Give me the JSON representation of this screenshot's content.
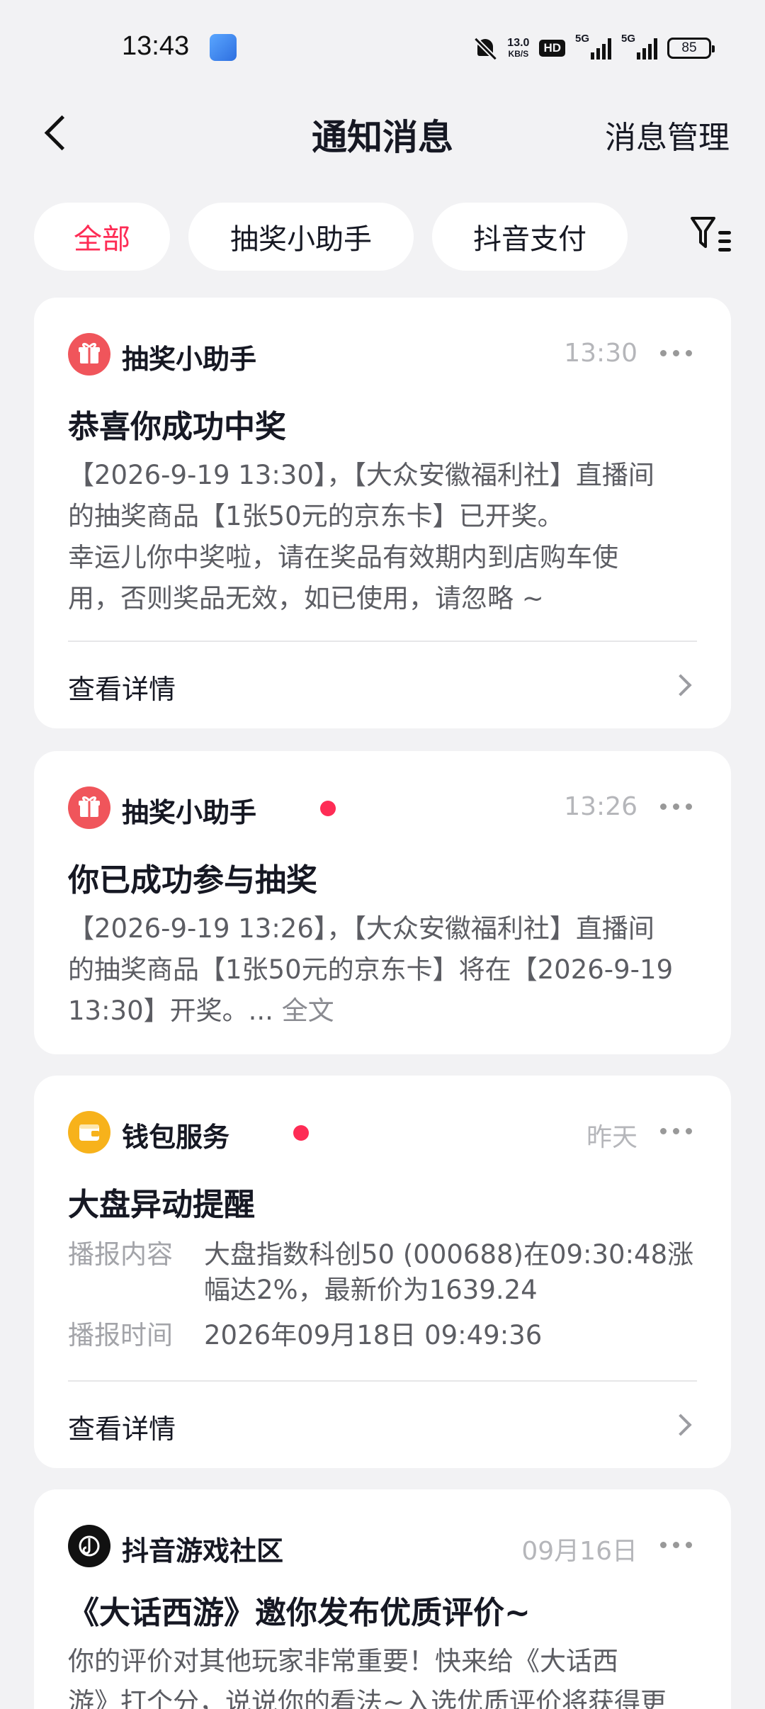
{
  "status_bar": {
    "time": "13:43",
    "net_speed_value": "13.0",
    "net_speed_unit": "KB/S",
    "hd": "HD",
    "signal1": "5G",
    "signal2": "5G",
    "battery": "85"
  },
  "nav": {
    "title": "通知消息",
    "manage": "消息管理"
  },
  "filters": {
    "items": [
      "全部",
      "抽奖小助手",
      "抖音支付"
    ],
    "active_index": 0
  },
  "cards": [
    {
      "sender": "抽奖小助手",
      "time": "13:30",
      "title": "恭喜你成功中奖",
      "body_lines": [
        "【2026-9-19 13:30】，【大众安徽福利社】直播间",
        "的抽奖商品【1张50元的京东卡】已开奖。",
        "幸运儿你中奖啦，请在奖品有效期内到店购车使",
        "用，否则奖品无效，如已使用，请忽略 ~"
      ],
      "detail": "查看详情"
    },
    {
      "sender": "抽奖小助手",
      "time": "13:26",
      "title": "你已成功参与抽奖",
      "body_lines": [
        "【2026-9-19 13:26】，【大众安徽福利社】直播间",
        "的抽奖商品【1张50元的京东卡】将在【2026-9-19",
        "13:30】开奖。..."
      ],
      "full_text": "全文"
    },
    {
      "sender": "钱包服务",
      "time": "昨天",
      "title": "大盘异动提醒",
      "content_label": "播报内容",
      "content_lines": [
        "大盘指数科创50  (000688)在09:30:48涨",
        "幅达2%，最新价为1639.24"
      ],
      "time_label": "播报时间",
      "time_value": "2026年09月18日 09:49:36",
      "detail": "查看详情"
    },
    {
      "sender": "抖音游戏社区",
      "time": "09月16日",
      "title": "《大话西游》邀你发布优质评价~",
      "body_lines": [
        "你的评价对其他玩家非常重要！快来给《大话西",
        "游》打个分，说说你的看法~入选优质评价将获得更"
      ]
    }
  ],
  "colors": {
    "accent": "#fe2c55",
    "background": "#f2f2f4"
  }
}
